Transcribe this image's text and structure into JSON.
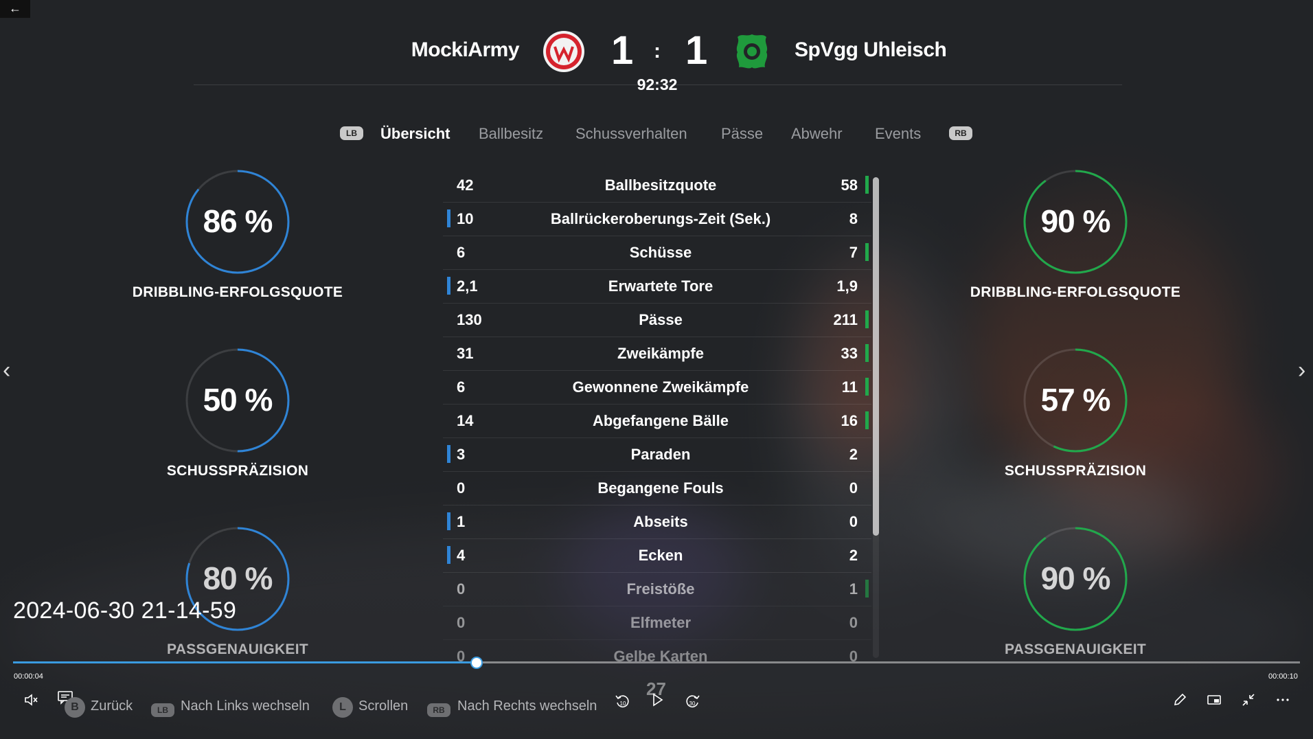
{
  "header": {
    "home_team": "MockiArmy",
    "away_team": "SpVgg Uhleisch",
    "home_score": "1",
    "separator": ":",
    "away_score": "1",
    "clock": "92:32"
  },
  "tabs": {
    "lb": "LB",
    "rb": "RB",
    "items": [
      "Übersicht",
      "Ballbesitz",
      "Schussverhalten",
      "Pässe",
      "Abwehr",
      "Events"
    ]
  },
  "left_stats": [
    {
      "value": "86 %",
      "label": "DRIBBLING-ERFOLGSQUOTE",
      "fill": 0.86
    },
    {
      "value": "50 %",
      "label": "SCHUSSPRÄZISION",
      "fill": 0.5
    },
    {
      "value": "80 %",
      "label": "PASSGENAUIGKEIT",
      "fill": 0.8
    }
  ],
  "right_stats": [
    {
      "value": "90 %",
      "label": "DRIBBLING-ERFOLGSQUOTE",
      "fill": 0.9
    },
    {
      "value": "57 %",
      "label": "SCHUSSPRÄZISION",
      "fill": 0.57
    },
    {
      "value": "90 %",
      "label": "PASSGENAUIGKEIT",
      "fill": 0.9
    }
  ],
  "stats_table": [
    {
      "home": "42",
      "label": "Ballbesitzquote",
      "away": "58",
      "leader": "away"
    },
    {
      "home": "10",
      "label": "Ballrückeroberungs-Zeit (Sek.)",
      "away": "8",
      "leader": "home"
    },
    {
      "home": "6",
      "label": "Schüsse",
      "away": "7",
      "leader": "away"
    },
    {
      "home": "2,1",
      "label": "Erwartete Tore",
      "away": "1,9",
      "leader": "home"
    },
    {
      "home": "130",
      "label": "Pässe",
      "away": "211",
      "leader": "away"
    },
    {
      "home": "31",
      "label": "Zweikämpfe",
      "away": "33",
      "leader": "away"
    },
    {
      "home": "6",
      "label": "Gewonnene Zweikämpfe",
      "away": "11",
      "leader": "away"
    },
    {
      "home": "14",
      "label": "Abgefangene Bälle",
      "away": "16",
      "leader": "away"
    },
    {
      "home": "3",
      "label": "Paraden",
      "away": "2",
      "leader": "home"
    },
    {
      "home": "0",
      "label": "Begangene Fouls",
      "away": "0",
      "leader": "none"
    },
    {
      "home": "1",
      "label": "Abseits",
      "away": "0",
      "leader": "home"
    },
    {
      "home": "4",
      "label": "Ecken",
      "away": "2",
      "leader": "home"
    },
    {
      "home": "0",
      "label": "Freistöße",
      "away": "1",
      "leader": "away"
    },
    {
      "home": "0",
      "label": "Elfmeter",
      "away": "0",
      "leader": "none"
    },
    {
      "home": "0",
      "label": "Gelbe Karten",
      "away": "0",
      "leader": "none"
    }
  ],
  "player": {
    "timestamp": "2024-06-30 21-14-59",
    "elapsed": "00:00:04",
    "duration": "00:00:10",
    "progress": 0.36,
    "rewind_label": "10",
    "forward_label": "30",
    "ghost_number": "27"
  },
  "legend": {
    "back_btn": "B",
    "back_label": "Zurück",
    "lb_btn": "LB",
    "left_label": "Nach Links wechseln",
    "l_btn": "L",
    "scroll_label": "Scrollen",
    "rb_btn": "RB",
    "right_label": "Nach Rechts wechseln"
  },
  "colors": {
    "home_accent": "#2f84d6",
    "away_accent": "#21a84b",
    "background": "#222427"
  }
}
